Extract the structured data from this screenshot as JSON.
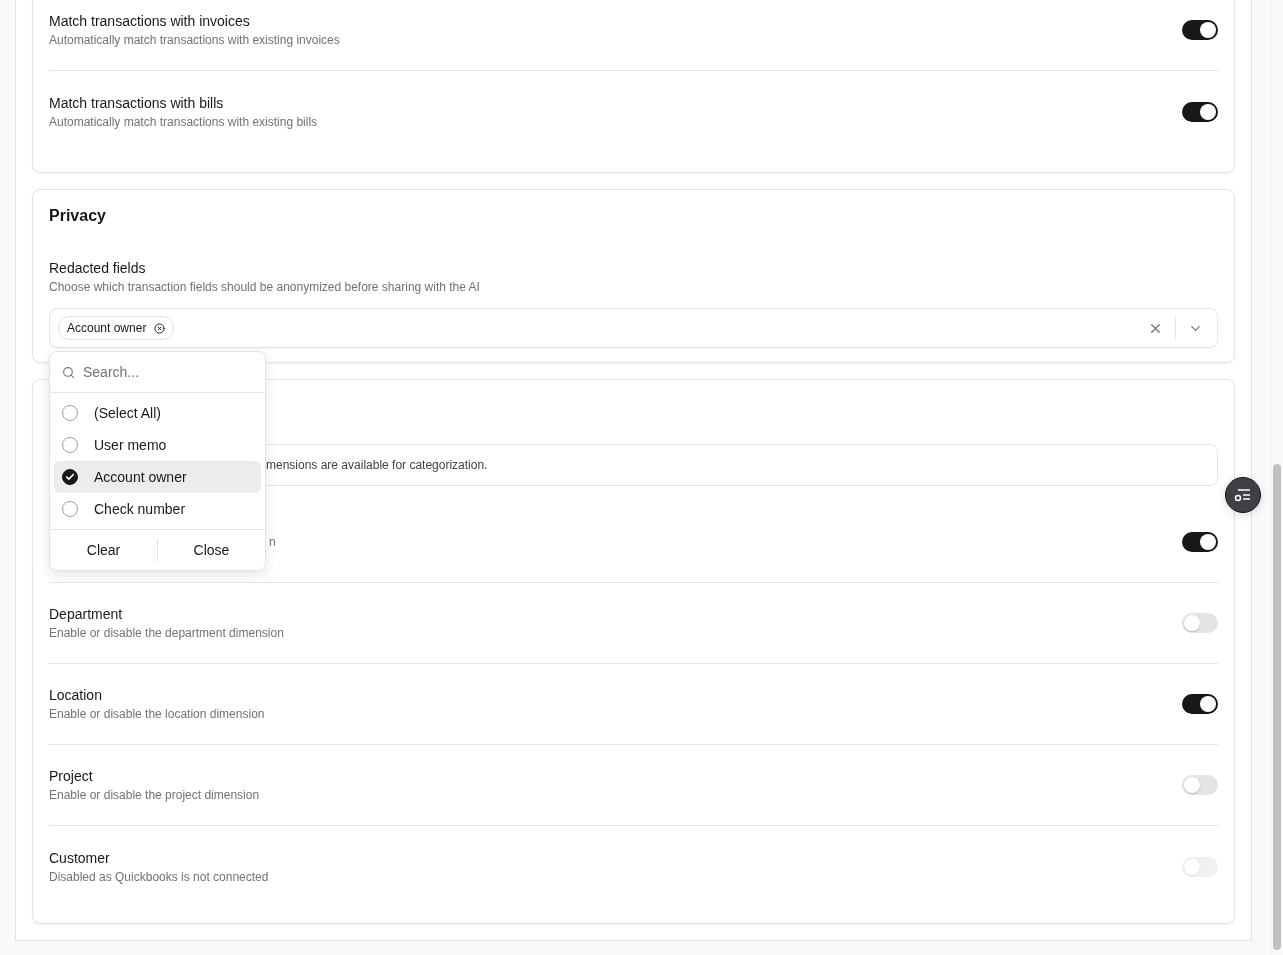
{
  "matching_rows": [
    {
      "title": "Match transactions with invoices",
      "description": "Automatically match transactions with existing invoices",
      "on": true,
      "disabled": false
    },
    {
      "title": "Match transactions with bills",
      "description": "Automatically match transactions with existing bills",
      "on": true,
      "disabled": false
    }
  ],
  "privacy": {
    "title": "Privacy",
    "field": {
      "label": "Redacted fields",
      "description": "Choose which transaction fields should be anonymized before sharing with the AI",
      "chips": [
        {
          "label": "Account owner"
        }
      ]
    },
    "dropdown": {
      "placeholder": "Search...",
      "options": [
        {
          "label": "(Select All)",
          "checked": false,
          "highlighted": false
        },
        {
          "label": "User memo",
          "checked": false,
          "highlighted": false
        },
        {
          "label": "Account owner",
          "checked": true,
          "highlighted": true
        },
        {
          "label": "Check number",
          "checked": false,
          "highlighted": false
        }
      ],
      "buttons": [
        "Clear",
        "Close"
      ]
    }
  },
  "dimensions": {
    "info": "mensions are available for categorization.",
    "rows": [
      {
        "description": "n",
        "on": true,
        "disabled": false
      },
      {
        "title": "Department",
        "description": "Enable or disable the department dimension",
        "on": false,
        "disabled": false
      },
      {
        "title": "Location",
        "description": "Enable or disable the location dimension",
        "on": true,
        "disabled": false
      },
      {
        "title": "Project",
        "description": "Enable or disable the project dimension",
        "on": false,
        "disabled": false
      },
      {
        "title": "Customer",
        "description": "Disabled as Quickbooks is not connected",
        "on": false,
        "disabled": true
      }
    ]
  }
}
